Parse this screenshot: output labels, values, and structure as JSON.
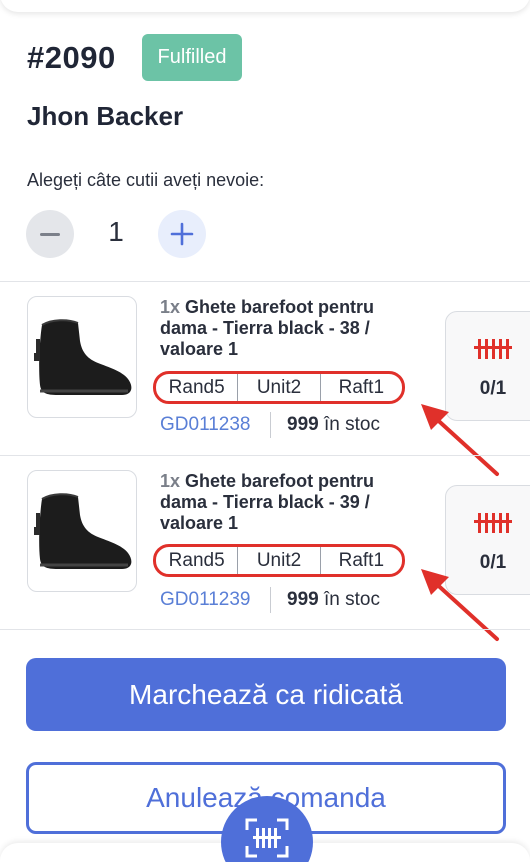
{
  "order": {
    "id": "#2090",
    "status": "Fulfilled",
    "customer": "Jhon Backer"
  },
  "boxes": {
    "label": "Alegeți câte cutii aveți nevoie:",
    "value": "1"
  },
  "products": [
    {
      "qty": "1x",
      "title": "Ghete barefoot pentru dama - Tierra black - 38 / valoare 1",
      "location": [
        "Rand5",
        "Unit2",
        "Raft1"
      ],
      "sku": "GD011238",
      "stock_count": "999",
      "stock_label": "în stoc",
      "picked": "0/1"
    },
    {
      "qty": "1x",
      "title": "Ghete barefoot pentru dama - Tierra black - 39 / valoare 1",
      "location": [
        "Rand5",
        "Unit2",
        "Raft1"
      ],
      "sku": "GD011239",
      "stock_count": "999",
      "stock_label": "în stoc",
      "picked": "0/1"
    }
  ],
  "actions": {
    "mark_picked": "Marchează ca ridicată",
    "cancel_order": "Anulează comanda"
  },
  "colors": {
    "accent": "#4f6fd9",
    "status_fulfilled": "#6cc3a6",
    "annotation_red": "#e0302a"
  },
  "icons": {
    "barcode": "barcode-icon",
    "scan": "scan-icon",
    "plus": "plus-icon",
    "minus": "minus-icon"
  }
}
